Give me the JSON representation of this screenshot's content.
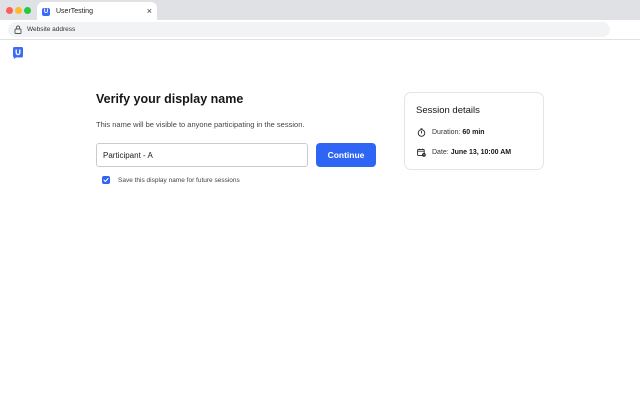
{
  "browser": {
    "tab_title": "UserTesting",
    "tab_close": "×",
    "address": "Website address"
  },
  "page": {
    "title": "Verify your display name",
    "subtitle": "This name will be visible to anyone participating in the session.",
    "display_name_value": "Participant - A",
    "continue_label": "Continue",
    "save_checkbox_label": "Save this display name for future sessions",
    "save_checked": true
  },
  "session_details": {
    "title": "Session details",
    "duration_label": "Duration:",
    "duration_value": "60 min",
    "date_label": "Date:",
    "date_value": "June 13, 10:00 AM"
  },
  "colors": {
    "accent": "#2f65f4",
    "brand": "#3b6cf6"
  }
}
